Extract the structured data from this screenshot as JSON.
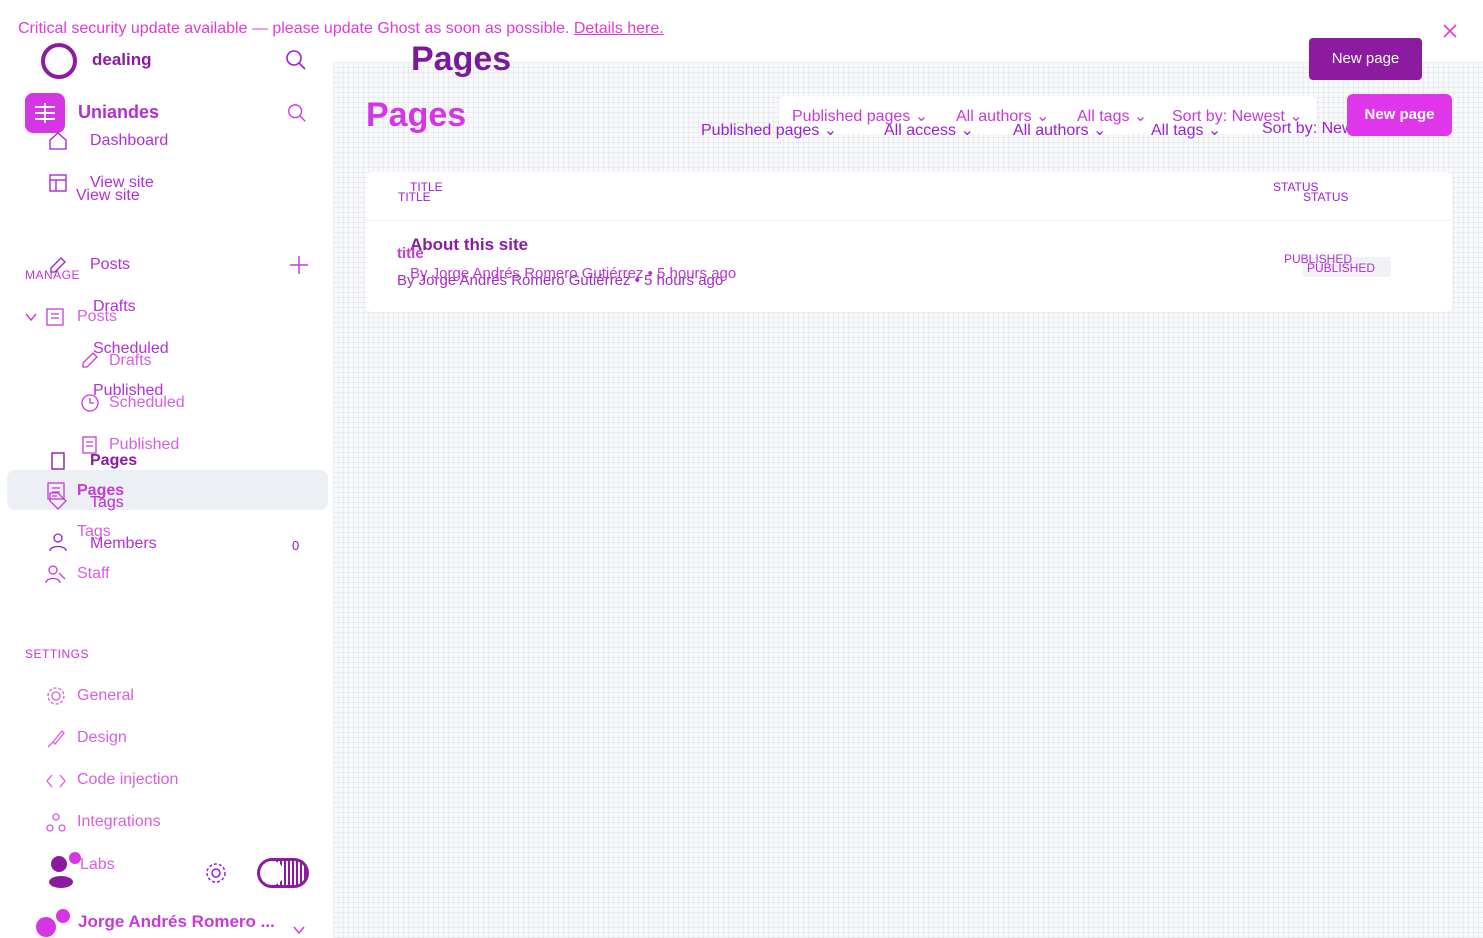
{
  "banner": {
    "text": "Critical security update available — please update Ghost as soon as possible.",
    "link": "Details here."
  },
  "topbar": {
    "site_name": "dealing",
    "page_title": "Pages",
    "new_button": "New page"
  },
  "sidebar": {
    "site_name": "Uniandes",
    "nav_primary": {
      "dashboard": "Dashboard",
      "view_site_a": "View site",
      "view_site_b": "View site"
    },
    "manage_head": "MANAGE",
    "posts_a": "Posts",
    "posts_b": "Posts",
    "drafts_a": "Drafts",
    "drafts_b": "Drafts",
    "scheduled_a": "Scheduled",
    "scheduled_b": "Scheduled",
    "published_a": "Published",
    "published_b": "Published",
    "pages_a": "Pages",
    "pages_b": "Pages",
    "tags_a": "Tags",
    "tags_b": "Tags",
    "members": "Members",
    "members_count": "0",
    "staff": "Staff",
    "settings_head": "SETTINGS",
    "general": "General",
    "design": "Design",
    "code_injection": "Code injection",
    "integrations": "Integrations",
    "labs": "Labs",
    "user_name": "Jorge Andrés Romero ..."
  },
  "main": {
    "title": "Pages",
    "filters_a": {
      "type": "Published pages",
      "authors": "All authors",
      "tags": "All tags",
      "sort": "Sort by: Newest"
    },
    "filters_b": {
      "type": "Published pages",
      "access": "All access",
      "authors": "All authors",
      "tags": "All tags",
      "sort": "Sort by: Newest"
    },
    "new_button": "New page",
    "columns": {
      "title_a": "TITLE",
      "title_b": "TITLE",
      "status_a": "STATUS",
      "status_b": "STATUS"
    },
    "rows": [
      {
        "title_a": "About this site",
        "title_b": "title",
        "meta_a": "By Jorge Andrés Romero Gutiérrez • 5 hours ago",
        "meta_b": "By Jorge Andrés Romero Gutiérrez • 5 hours ago",
        "status_a": "PUBLISHED",
        "status_b": "PUBLISHED"
      }
    ]
  },
  "colors": {
    "accent": "#df36ea",
    "dark_accent": "#8c1ba0",
    "text": "#9b1fd1"
  }
}
